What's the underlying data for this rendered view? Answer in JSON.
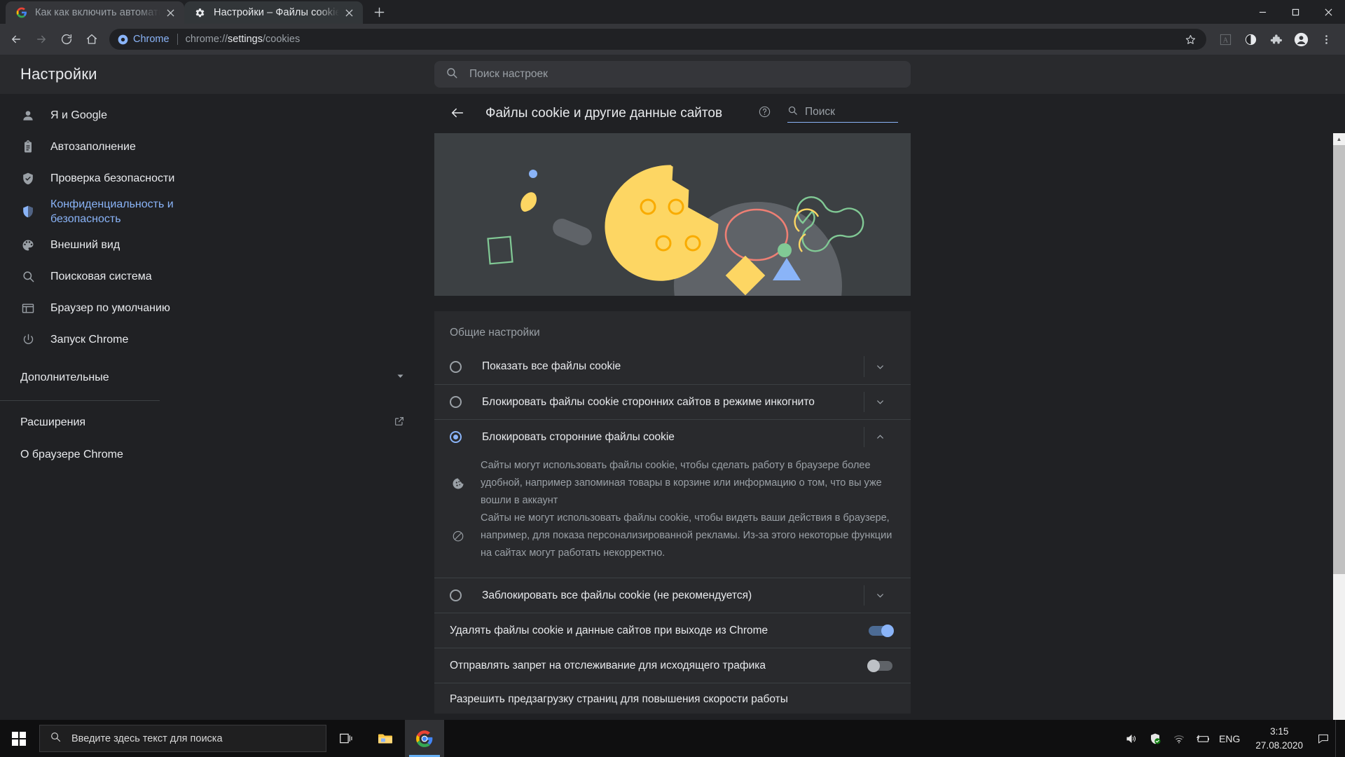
{
  "window": {
    "tabs": [
      {
        "title": "Как как включить автоматичес",
        "favicon": "google-icon",
        "active": false
      },
      {
        "title": "Настройки – Файлы cookie и др",
        "favicon": "gear-icon",
        "active": true
      }
    ],
    "new_tab_label": "+",
    "controls": {
      "minimize": "—",
      "maximize": "❐",
      "close": "✕"
    }
  },
  "toolbar": {
    "back": "back-arrow-icon",
    "forward": "forward-arrow-icon",
    "reload": "reload-icon",
    "home": "home-icon",
    "omnibox": {
      "badge": "Chrome",
      "url_prefix": "chrome://",
      "url_bold": "settings",
      "url_suffix": "/cookies"
    },
    "star": "star-icon",
    "pdf": "pdf-icon",
    "theme": "theme-contrast-icon",
    "extensions": "puzzle-icon",
    "profile": "avatar-icon",
    "menu": "three-dot-menu-icon"
  },
  "settings": {
    "brand": "Настройки",
    "search_placeholder": "Поиск настроек"
  },
  "sidebar": {
    "items": [
      {
        "label": "Я и Google",
        "icon": "person-icon",
        "selected": false
      },
      {
        "label": "Автозаполнение",
        "icon": "clipboard-icon",
        "selected": false
      },
      {
        "label": "Проверка безопасности",
        "icon": "shield-check-icon",
        "selected": false
      },
      {
        "label": "Конфиденциальность и безопасность",
        "icon": "shield-icon",
        "selected": true
      },
      {
        "label": "Внешний вид",
        "icon": "palette-icon",
        "selected": false
      },
      {
        "label": "Поисковая система",
        "icon": "search-icon",
        "selected": false
      },
      {
        "label": "Браузер по умолчанию",
        "icon": "browser-window-icon",
        "selected": false
      },
      {
        "label": "Запуск Chrome",
        "icon": "power-icon",
        "selected": false
      }
    ],
    "advanced": "Дополнительные",
    "extensions": "Расширения",
    "about": "О браузере Chrome"
  },
  "content": {
    "title": "Файлы cookie и другие данные сайтов",
    "back": "back-arrow-icon",
    "help": "help-circle-icon",
    "search_placeholder": "Поиск",
    "section_title": "Общие настройки",
    "options": [
      {
        "label": "Показать все файлы cookie",
        "selected": false,
        "expanded": false
      },
      {
        "label": "Блокировать файлы cookie сторонних сайтов в режиме инкогнито",
        "selected": false,
        "expanded": false
      },
      {
        "label": "Блокировать сторонние файлы cookie",
        "selected": true,
        "expanded": true
      },
      {
        "label": "Заблокировать все файлы cookie (не рекомендуется)",
        "selected": false,
        "expanded": false
      }
    ],
    "expanded_details": [
      {
        "icon": "cookie-icon",
        "text": "Сайты могут использовать файлы cookie, чтобы сделать работу в браузере более удобной, например запоминая товары в корзине или информацию о том, что вы уже вошли в аккаунт"
      },
      {
        "icon": "block-icon",
        "text": "Сайты не могут использовать файлы cookie, чтобы видеть ваши действия в браузере, например, для показа персонализированной рекламы. Из-за этого некоторые функции на сайтах могут работать некорректно."
      }
    ],
    "toggles": [
      {
        "label": "Удалять файлы cookie и данные сайтов при выходе из Chrome",
        "on": true
      },
      {
        "label": "Отправлять запрет на отслеживание для исходящего трафика",
        "on": false
      }
    ],
    "last_row_label": "Разрешить предзагрузку страниц для повышения скорости работы"
  },
  "colors": {
    "page_bg": "#202124",
    "card_bg": "#292a2d",
    "toolbar_bg": "#35363a",
    "accent": "#8ab4f8",
    "text": "#e8eaed",
    "muted": "#9aa0a6",
    "banner_bg": "#3c4043",
    "cookie_yellow": "#fdd663",
    "cookie_ring": "#f9ab00"
  },
  "taskbar": {
    "start": "windows-start-icon",
    "search_placeholder": "Введите здесь текст для поиска",
    "taskview": "task-view-icon",
    "explorer": "file-explorer-icon",
    "chrome": "chrome-icon",
    "tray": {
      "volume": "volume-icon",
      "defender": "shield-icon",
      "wifi": "wifi-icon",
      "battery": "battery-icon",
      "language": "ENG",
      "time": "3:15",
      "date": "27.08.2020",
      "notifications": "notification-icon"
    }
  }
}
